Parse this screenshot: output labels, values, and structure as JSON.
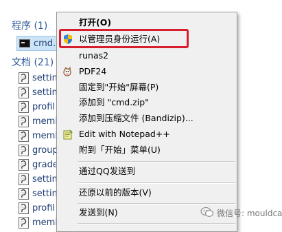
{
  "search_results": {
    "programs_header": "程序 (1)",
    "documents_header": "文档 (21)",
    "program_item": "cmd.e",
    "document_items": [
      "settin",
      "settin",
      "profil",
      "meml",
      "meml",
      "group",
      "grade",
      "settin",
      "settin",
      "profil",
      "meml"
    ]
  },
  "context_menu": {
    "items": [
      {
        "label": "打开(O)",
        "bold": true,
        "icon": ""
      },
      {
        "label": "以管理员身份运行(A)",
        "bold": false,
        "icon": "uac-shield-icon"
      },
      {
        "label": "runas2",
        "bold": false,
        "icon": ""
      },
      {
        "label": "PDF24",
        "bold": false,
        "icon": "pdf24-icon"
      },
      {
        "label": "固定到\"开始\"屏幕(P)",
        "bold": false,
        "icon": ""
      },
      {
        "label": "添加到 \"cmd.zip\"",
        "bold": false,
        "icon": ""
      },
      {
        "label": "添加到压缩文件 (Bandizip)...",
        "bold": false,
        "icon": ""
      },
      {
        "label": "Edit with Notepad++",
        "bold": false,
        "icon": "notepadpp-icon"
      },
      {
        "label": "附到「开始」菜单(U)",
        "bold": false,
        "icon": ""
      },
      {
        "label": "通过QQ发送到",
        "bold": false,
        "icon": ""
      },
      {
        "label": "还原以前的版本(V)",
        "bold": false,
        "icon": ""
      },
      {
        "label": "发送到(N)",
        "bold": false,
        "icon": ""
      }
    ]
  },
  "watermark": {
    "text": "微信号: mouldcad"
  },
  "colors": {
    "highlight_border": "#d81e2c",
    "menu_background": "#f0f0f0",
    "header_text": "#2b5797",
    "selection_background": "#cde4f7"
  }
}
